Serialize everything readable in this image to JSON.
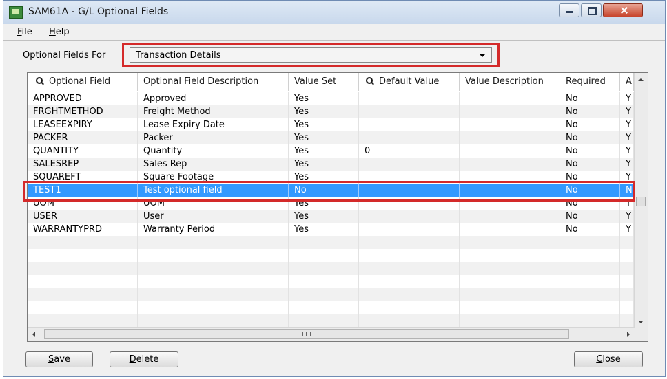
{
  "window": {
    "title": "SAM61A - G/L Optional Fields"
  },
  "menu": [
    {
      "key": "F",
      "rest": "ile"
    },
    {
      "key": "H",
      "rest": "elp"
    }
  ],
  "filter": {
    "label": "Optional Fields For",
    "selected": "Transaction Details"
  },
  "grid": {
    "columns": [
      "Optional Field",
      "Optional Field Description",
      "Value Set",
      "Default Value",
      "Value Description",
      "Required",
      "A"
    ],
    "rows": [
      {
        "field": "APPROVED",
        "description": "Approved",
        "value_set": "Yes",
        "default": "",
        "value_description": "",
        "required": "No",
        "auto": "Y"
      },
      {
        "field": "FRGHTMETHOD",
        "description": "Freight Method",
        "value_set": "Yes",
        "default": "",
        "value_description": "",
        "required": "No",
        "auto": "Y"
      },
      {
        "field": "LEASEEXPIRY",
        "description": "Lease Expiry Date",
        "value_set": "Yes",
        "default": "",
        "value_description": "",
        "required": "No",
        "auto": "Y"
      },
      {
        "field": "PACKER",
        "description": "Packer",
        "value_set": "Yes",
        "default": "",
        "value_description": "",
        "required": "No",
        "auto": "Y"
      },
      {
        "field": "QUANTITY",
        "description": "Quantity",
        "value_set": "Yes",
        "default": "0",
        "value_description": "",
        "required": "No",
        "auto": "Y"
      },
      {
        "field": "SALESREP",
        "description": "Sales Rep",
        "value_set": "Yes",
        "default": "",
        "value_description": "",
        "required": "No",
        "auto": "Y"
      },
      {
        "field": "SQUAREFT",
        "description": "Square Footage",
        "value_set": "Yes",
        "default": "",
        "value_description": "",
        "required": "No",
        "auto": "Y"
      },
      {
        "field": "TEST1",
        "description": "Test optional field",
        "value_set": "No",
        "default": "",
        "value_description": "",
        "required": "No",
        "auto": "N"
      },
      {
        "field": "UOM",
        "description": "UOM",
        "value_set": "Yes",
        "default": "",
        "value_description": "",
        "required": "No",
        "auto": "Y"
      },
      {
        "field": "USER",
        "description": "User",
        "value_set": "Yes",
        "default": "",
        "value_description": "",
        "required": "No",
        "auto": "Y"
      },
      {
        "field": "WARRANTYPRD",
        "description": "Warranty Period",
        "value_set": "Yes",
        "default": "",
        "value_description": "",
        "required": "No",
        "auto": "Y"
      }
    ],
    "selected_row": "TEST1"
  },
  "buttons": {
    "save": {
      "key": "S",
      "rest": "ave"
    },
    "delete": {
      "key": "D",
      "rest": "elete"
    },
    "close": {
      "key": "C",
      "rest": "lose"
    }
  },
  "colors": {
    "selection": "#3399ff",
    "highlight_box": "#d42a2a"
  },
  "icons": [
    "app-icon",
    "search-icon",
    "minimize-icon",
    "maximize-icon",
    "close-icon"
  ]
}
